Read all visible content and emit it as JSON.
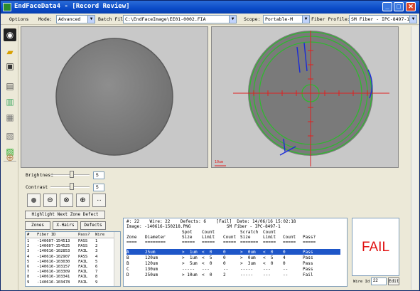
{
  "window": {
    "title": "EndFaceData4 - [Record Review]",
    "min": "_",
    "max": "□",
    "close": "✕"
  },
  "toolbar": {
    "options_label": "Options",
    "mode_label": "Mode:",
    "mode_value": "Advanced",
    "batch_label": "Batch File:",
    "batch_value": "C:\\EndFaceImage\\EE01-0002.FIA",
    "scope_label": "Scope:",
    "scope_value": "Portable-M",
    "profile_label": "Fiber Profile:",
    "profile_value": "SM Fiber - IPC-8497-1"
  },
  "left_tools": [
    "camera-icon",
    "folder-icon",
    "archive-icon",
    "layout-icon",
    "notes-icon",
    "grid-icon",
    "print-icon",
    "export-icon",
    "crosshair-icon"
  ],
  "scale_label": "10um",
  "controls": {
    "brightness_label": "Brightness",
    "brightness_value": "5",
    "brightness_level": 0.55,
    "contrast_label": "Contrast",
    "contrast_value": "5",
    "contrast_level": 0.55,
    "highlight_label": "Highlight Next Zone Defect",
    "zones_label": "Zones",
    "xhairs_label": "X-Hairs",
    "defects_label": "Defects"
  },
  "list": {
    "headers": [
      "#",
      "Fiber ID",
      "Pass?",
      "Wire"
    ],
    "rows": [
      [
        "1",
        "-140607-154513",
        "PASS",
        "1"
      ],
      [
        "2",
        "-140607-154525",
        "PASS",
        "2"
      ],
      [
        "3",
        "-140616-102853",
        "FAIL",
        "3"
      ],
      [
        "4",
        "-140616-102907",
        "PASS",
        "4"
      ],
      [
        "5",
        "-140616-103030",
        "FAIL",
        "5"
      ],
      [
        "6",
        "-140616-103157",
        "FAIL",
        "6"
      ],
      [
        "7",
        "-140616-103309",
        "FAIL",
        "7"
      ],
      [
        "8",
        "-140616-103341",
        "FAIL",
        "8"
      ],
      [
        "9",
        "-140616-103478",
        "FAIL",
        "9"
      ]
    ]
  },
  "report": {
    "line1": "#: 22    Wire: 22    Defects: 6    [Fail]  Date: 14/06/16 15:02:18",
    "line2": "Image: -140616-150218.PNG              SM Fiber - IPC-8497-1",
    "head1": [
      "",
      "",
      "Spot",
      "Count",
      "",
      "Scratch",
      "Count",
      "",
      ""
    ],
    "head2": [
      "Zone",
      "Diameter",
      "Size",
      "Limit",
      "Count",
      "Size",
      "Limit",
      "Count",
      "Pass?"
    ],
    "sep": [
      "====",
      "========",
      "=====",
      "=====",
      "=====",
      "=======",
      "=====",
      "=====",
      "====="
    ],
    "rows": [
      [
        "A",
        "25um",
        ">  1um",
        "<  0",
        "0",
        ">  0um",
        "<  0",
        "0",
        "Pass"
      ],
      [
        "B",
        "120um",
        ">  1um",
        "<  5",
        "0",
        ">  0um",
        "<  5",
        "4",
        "Pass"
      ],
      [
        "B",
        "120um",
        ">  5um",
        "<  0",
        "0",
        ">  3um",
        "<  0",
        "0",
        "Pass"
      ],
      [
        "C",
        "130um",
        "-----",
        "---",
        "--",
        "-----",
        "---",
        "--",
        "Pass"
      ],
      [
        "D",
        "250um",
        "> 10um",
        "<  0",
        "2",
        "-----",
        "---",
        "--",
        "Fail"
      ]
    ]
  },
  "result": "FAIL",
  "wire": {
    "label": "Wire Id",
    "value": "22",
    "edit_label": "Edit"
  }
}
